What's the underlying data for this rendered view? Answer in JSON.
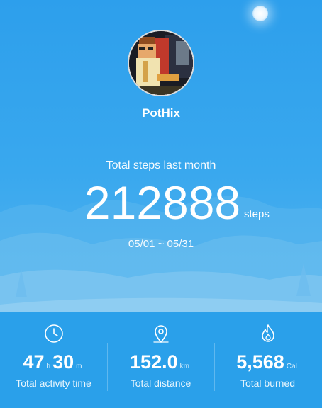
{
  "profile": {
    "username": "PotHix",
    "avatar_icon": "pixel-art-avatar"
  },
  "summary": {
    "label": "Total steps last month",
    "steps_value": "212888",
    "steps_unit": "steps",
    "date_range": "05/01 ~ 05/31"
  },
  "stats": {
    "activity": {
      "icon": "clock-icon",
      "hours": "47",
      "hours_unit": "h",
      "minutes": "30",
      "minutes_unit": "m",
      "label": "Total activity time"
    },
    "distance": {
      "icon": "location-pin-icon",
      "value": "152.0",
      "unit": "km",
      "label": "Total distance"
    },
    "burned": {
      "icon": "flame-icon",
      "value": "5,568",
      "unit": "Cal",
      "label": "Total burned"
    }
  },
  "colors": {
    "background": "#2aa0ea",
    "hero_top": "#2d9fec",
    "text": "#ffffff"
  }
}
